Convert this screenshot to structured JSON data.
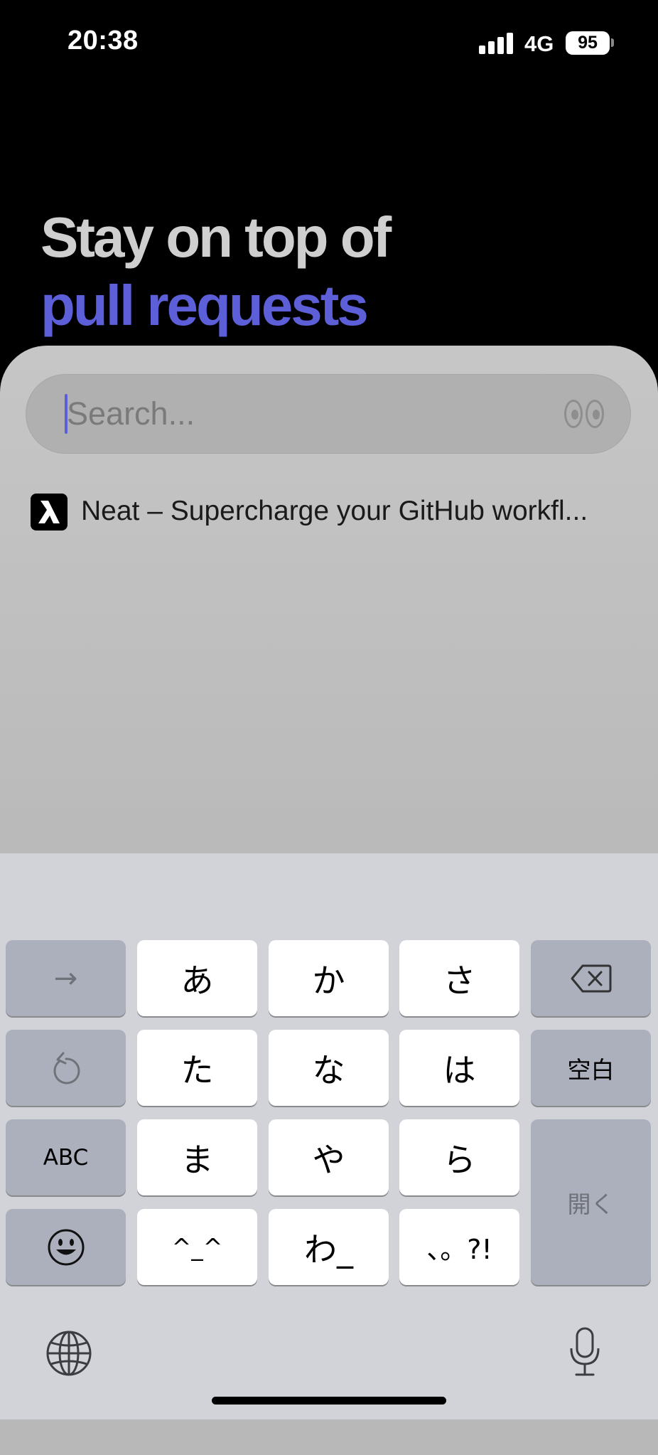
{
  "status_bar": {
    "time": "20:38",
    "network": "4G",
    "battery": "95"
  },
  "headline": {
    "line1": "Stay on top of",
    "line2": "pull requests"
  },
  "search": {
    "placeholder": "Search...",
    "value": ""
  },
  "suggestion": {
    "app_icon": "neat-logo-icon",
    "label": "Neat – Supercharge your GitHub workfl..."
  },
  "keyboard": {
    "rows": [
      [
        "→",
        "あ",
        "か",
        "さ",
        "delete"
      ],
      [
        "undo",
        "た",
        "な",
        "は",
        "空白"
      ],
      [
        "ABC",
        "ま",
        "や",
        "ら",
        "開く"
      ],
      [
        "emoji",
        "^_^",
        "わ_",
        "、。?!"
      ]
    ],
    "next_key": "→",
    "keys": {
      "a": "あ",
      "ka": "か",
      "sa": "さ",
      "ta": "た",
      "na": "な",
      "ha": "は",
      "ma": "ま",
      "ya": "や",
      "ra": "ら",
      "kaomoji": "^_^",
      "wa": "わ_",
      "punct": "、。?!"
    },
    "abc_label": "ABC",
    "space_label": "空白",
    "return_label": "開く",
    "icons": [
      "delete-icon",
      "undo-icon",
      "emoji-icon",
      "globe-icon",
      "microphone-icon"
    ]
  },
  "colors": {
    "accent": "#5c5fd8",
    "keyboard_bg": "#d1d3d9",
    "key_gray": "#abb0bc"
  }
}
